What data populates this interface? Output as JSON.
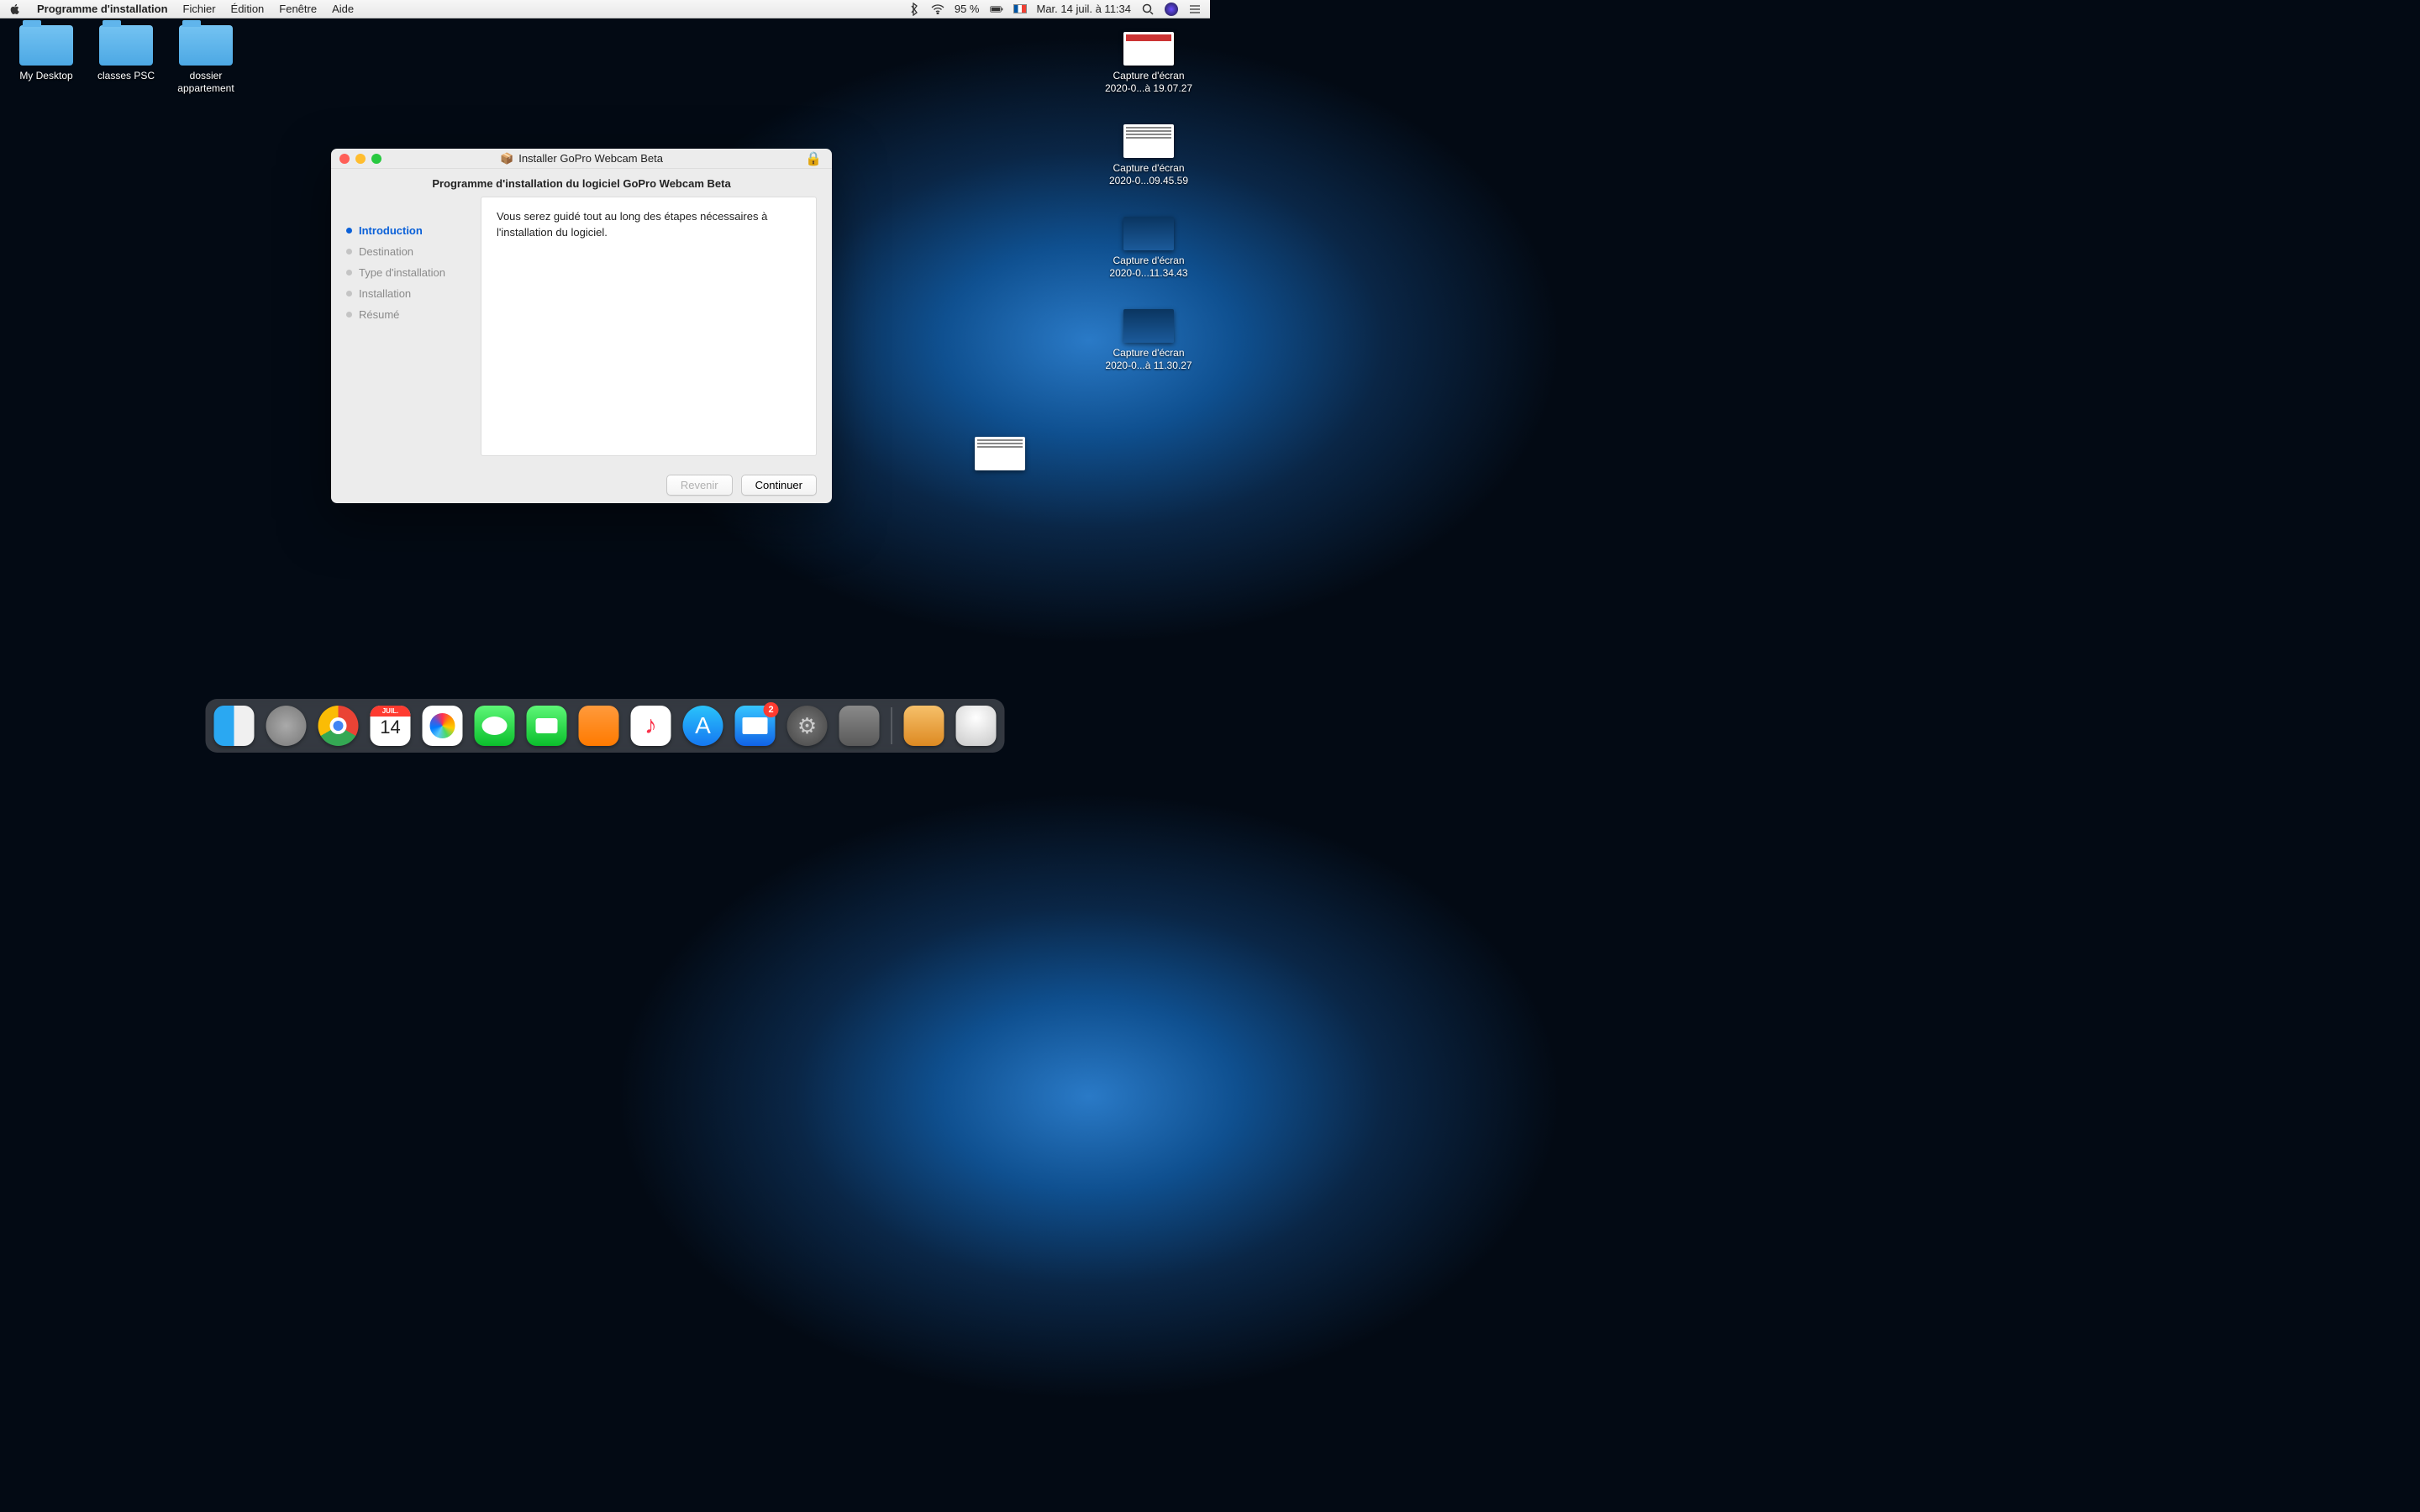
{
  "menubar": {
    "apple": "",
    "app": "Programme d'installation",
    "items": [
      "Fichier",
      "Édition",
      "Fenêtre",
      "Aide"
    ],
    "battery_pct": "95 %",
    "flag": "🇫🇷",
    "datetime": "Mar. 14 juil. à  11:34"
  },
  "desktop": {
    "folders": [
      {
        "name": "My Desktop"
      },
      {
        "name": "classes PSC"
      },
      {
        "name": "dossier appartement"
      }
    ],
    "shots": [
      {
        "name": "Capture d'écran 2020-0...à 19.07.27"
      },
      {
        "name": "Capture d'écran 2020-0...09.45.59"
      },
      {
        "name": "Capture d'écran 2020-0...11.34.43"
      },
      {
        "name": "Capture d'écran 2020-0...à 11.30.27"
      }
    ]
  },
  "installer": {
    "title": "Installer GoPro Webcam Beta",
    "subtitle": "Programme d'installation du logiciel GoPro Webcam Beta",
    "steps": [
      "Introduction",
      "Destination",
      "Type d'installation",
      "Installation",
      "Résumé"
    ],
    "active_step": 0,
    "body": "Vous serez guidé tout au long des étapes nécessaires à l'installation du logiciel.",
    "back": "Revenir",
    "continue": "Continuer"
  },
  "dock": {
    "cal_month": "JUIL.",
    "cal_day": "14",
    "mail_badge": "2"
  }
}
